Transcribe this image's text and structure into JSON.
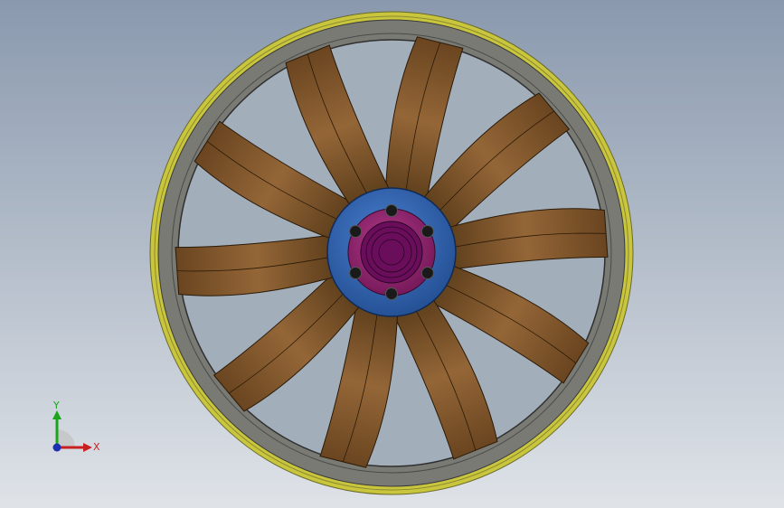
{
  "viewport": {
    "colors": {
      "background_top": "#8a99ae",
      "background_bottom": "#dfe3e8",
      "outer_rim": "#c9c63e",
      "shroud": "#6e6e6e",
      "blade": "#7a5327",
      "hub_ring": "#2f5ea8",
      "hub_plate": "#8e1f6a",
      "hub_center": "#6a0e5c",
      "bolt": "#1a1a1a"
    }
  },
  "model": {
    "blade_count": 10,
    "bolt_count": 6
  },
  "triad": {
    "y_label": "Y",
    "x_label": "X",
    "y_color": "#1aa51a",
    "x_color": "#c82020",
    "z_color": "#1c2fb0"
  }
}
